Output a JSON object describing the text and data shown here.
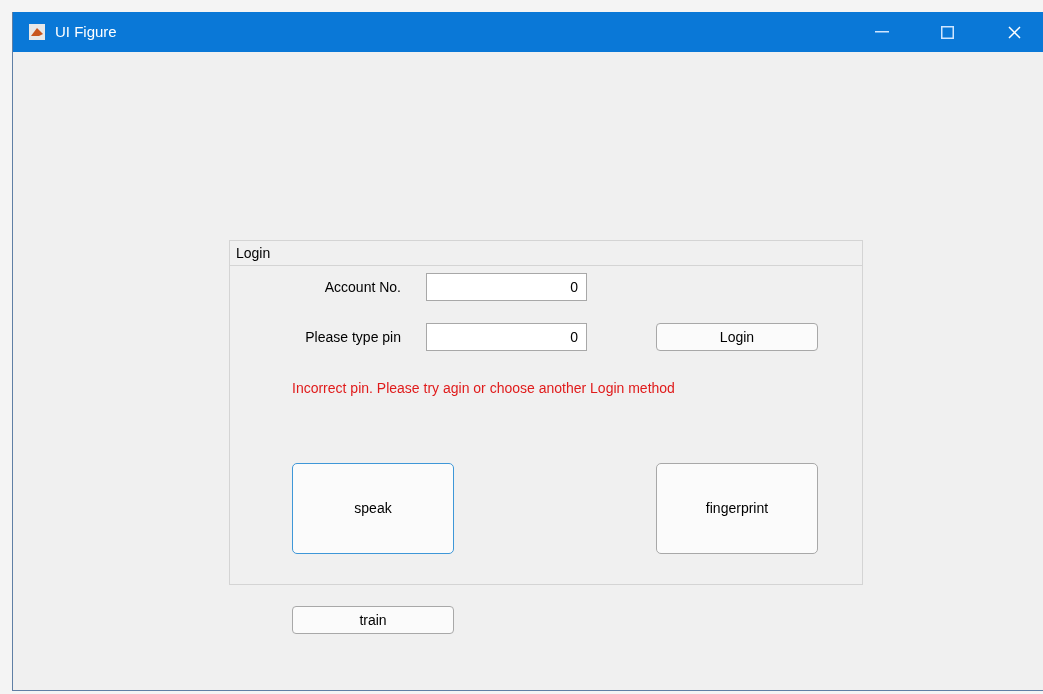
{
  "window": {
    "title": "UI Figure"
  },
  "login_panel": {
    "title": "Login",
    "fields": [
      {
        "label": "Account No.",
        "value": "0"
      },
      {
        "label": "Please type pin",
        "value": "0"
      }
    ],
    "login_button": "Login",
    "error_message": "Incorrect pin. Please try agin or choose another Login method",
    "method_buttons": [
      {
        "label": "speak",
        "focused": true
      },
      {
        "label": "fingerprint",
        "focused": false
      }
    ]
  },
  "train_button": "train"
}
